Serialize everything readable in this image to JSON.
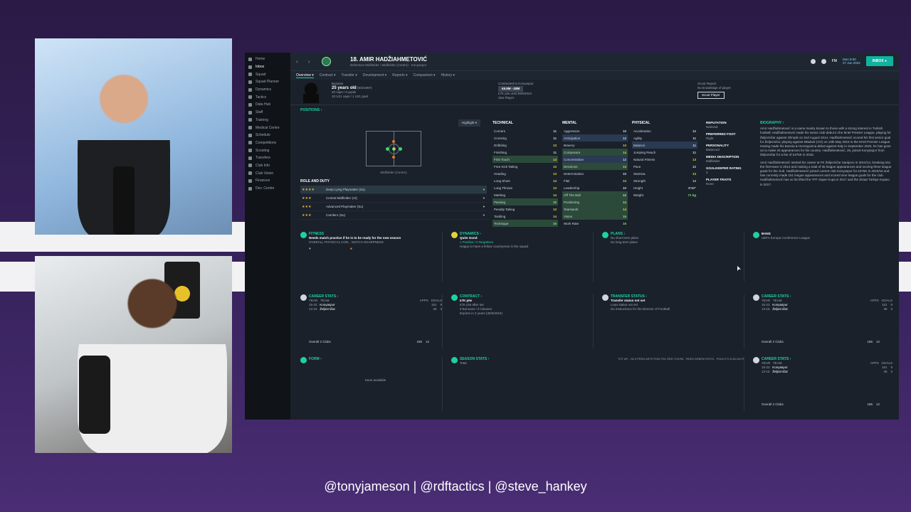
{
  "overlay": {
    "handles": "@tonyjameson | @rdftactics | @steve_hankey"
  },
  "sidebar": {
    "items": [
      {
        "label": "Home"
      },
      {
        "label": "Inbox"
      },
      {
        "label": "Squad"
      },
      {
        "label": "Squad Planner"
      },
      {
        "label": "Dynamics"
      },
      {
        "label": "Tactics"
      },
      {
        "label": "Data Hub"
      },
      {
        "label": "Staff"
      },
      {
        "label": "Training"
      },
      {
        "label": "Medical Centre"
      },
      {
        "label": "Schedule"
      },
      {
        "label": "Competitions"
      },
      {
        "label": "Scouting"
      },
      {
        "label": "Transfers"
      },
      {
        "label": "Club Info"
      },
      {
        "label": "Club Vision"
      },
      {
        "label": "Finances"
      },
      {
        "label": "Dev. Centre"
      }
    ]
  },
  "topbar": {
    "title": "18. AMIR HADŽIAHMETOVIĆ",
    "subtitle": "Defensive Midfielder / Midfielder (Centre) · Konyaspor",
    "fm": "FM",
    "date_day": "Mon 8:00",
    "date": "27 Jun 2022",
    "inbox": "INBOX"
  },
  "tabs": [
    {
      "label": "Overview ▾"
    },
    {
      "label": "Contract ▾"
    },
    {
      "label": "Transfer ▾"
    },
    {
      "label": "Development ▾"
    },
    {
      "label": "Reports ▾"
    },
    {
      "label": "Comparison ▾"
    },
    {
      "label": "History ▾"
    }
  ],
  "header": {
    "nation": "Bosnian",
    "age": "25 years old",
    "dob": "(8/3/1997)",
    "caps": "20 caps / 0 goals",
    "u21": "10 U21 caps / 1 U21 goal",
    "contracted": "Contracted to Konyaspor",
    "value": "£6.9M - £8M",
    "wage": "£7K p/w until 30/6/2024",
    "status": "Star Player",
    "scout_title": "Scout Report",
    "scout_text": "No knowledge of player",
    "scout_btn": "Scout Player"
  },
  "positions": {
    "title": "POSITIONS ›",
    "highlight": "Highlight ▾",
    "pitch_label": "Midfielder (Centre)",
    "role_title": "ROLE AND DUTY",
    "roles": [
      {
        "stars": "★★★★",
        "label": "Deep Lying Playmaker (Su)"
      },
      {
        "stars": "★★★",
        "label": "Central Midfielder (At)"
      },
      {
        "stars": "★★★",
        "label": "Advanced Playmaker (Su)"
      },
      {
        "stars": "★★★",
        "label": "Carrilero (Su)"
      }
    ]
  },
  "technical": {
    "title": "TECHNICAL",
    "rows": [
      {
        "k": "Corners",
        "v": "11"
      },
      {
        "k": "Crossing",
        "v": "11"
      },
      {
        "k": "Dribbling",
        "v": "13"
      },
      {
        "k": "Finishing",
        "v": "11"
      },
      {
        "k": "First Touch",
        "v": "14"
      },
      {
        "k": "Free Kick Taking",
        "v": "13"
      },
      {
        "k": "Heading",
        "v": "13"
      },
      {
        "k": "Long Shots",
        "v": "14"
      },
      {
        "k": "Long Throws",
        "v": "13"
      },
      {
        "k": "Marking",
        "v": "14"
      },
      {
        "k": "Passing",
        "v": "15"
      },
      {
        "k": "Penalty Taking",
        "v": "13"
      },
      {
        "k": "Tackling",
        "v": "14"
      },
      {
        "k": "Technique",
        "v": "15"
      }
    ]
  },
  "mental": {
    "title": "MENTAL",
    "rows": [
      {
        "k": "Aggression",
        "v": "10"
      },
      {
        "k": "Anticipation",
        "v": "12"
      },
      {
        "k": "Bravery",
        "v": "13"
      },
      {
        "k": "Composure",
        "v": "14"
      },
      {
        "k": "Concentration",
        "v": "12"
      },
      {
        "k": "Decisions",
        "v": "13"
      },
      {
        "k": "Determination",
        "v": "10"
      },
      {
        "k": "Flair",
        "v": "13"
      },
      {
        "k": "Leadership",
        "v": "10"
      },
      {
        "k": "Off The Ball",
        "v": "12"
      },
      {
        "k": "Positioning",
        "v": "14"
      },
      {
        "k": "Teamwork",
        "v": "14"
      },
      {
        "k": "Vision",
        "v": "15"
      },
      {
        "k": "Work Rate",
        "v": "15"
      }
    ]
  },
  "physical": {
    "title": "PHYSICAL",
    "rows": [
      {
        "k": "Acceleration",
        "v": "12"
      },
      {
        "k": "Agility",
        "v": "11"
      },
      {
        "k": "Balance",
        "v": "11"
      },
      {
        "k": "Jumping Reach",
        "v": "11"
      },
      {
        "k": "Natural Fitness",
        "v": "13"
      },
      {
        "k": "Pace",
        "v": "12"
      },
      {
        "k": "Stamina",
        "v": "13"
      },
      {
        "k": "Strength",
        "v": "13"
      },
      {
        "k": "Height",
        "v": "5'10\""
      },
      {
        "k": "Weight",
        "v": "71 kg"
      }
    ]
  },
  "info": {
    "reputation_k": "REPUTATION",
    "reputation_v": "National",
    "foot_k": "PREFERRED FOOT",
    "foot_v": "Right",
    "personality_k": "PERSONALITY",
    "personality_v": "Balanced",
    "media_k": "MEDIA DESCRIPTION",
    "media_v": "Midfielder",
    "gk_k": "GOALKEEPER RATING",
    "gk_v": "3",
    "traits_k": "PLAYER TRAITS",
    "traits_v": "None"
  },
  "bio": {
    "title": "BIOGRAPHY ›",
    "p1": "Amir Hadžiahmetović is a name mainly known to those with a strong interest in Turkish football. Hadžiahmetović made his senior club debut in the M:tel Premier League, playing for Željezničar against Olimpik on 2nd August 2014. Hadžiahmetović scored his first senior goal for Željezničar, playing against Mladost (VO) on 13th May 2015 in the M:tel Premier League. Having made his Bosnia & Herzegovina debut against Italy in September 2020, he has gone on to make 20 appearances for his country. Hadžiahmetović, 25, joined Konyaspor from Željezničar for a fee of £375K in 2016.",
    "p2": "Amir Hadžiahmetović started his career at FK Željezničar Sarajevo in 2013/14, breaking into the first-team in 2014 and making a total of 35 league appearances and scoring three league goals for the club. Hadžiahmetović joined current club Konyaspor for £375K in 2015/16 and has currently made 151 league appearances and scored nine league goals for the club. Hadžiahmetović has so far lifted the TFF Süper Kupa in 2017 and the Ziraat Türkiye Kupası in 2017."
  },
  "fitness": {
    "title": "FITNESS",
    "text": "Needs match practice if he is to be ready for the new season",
    "sub": "OVERALL PHYSICAL CON...    MATCH SHARPNESS"
  },
  "dynamics": {
    "title": "DYNAMICS ›",
    "mood": "Quite Good",
    "counts": "1 Positive  /  0 Negatives",
    "text": "Happy to have a fellow countryman in the squad"
  },
  "plans": {
    "title": "PLANS ›",
    "a": "No short term plans",
    "b": "No long term plans"
  },
  "bans": {
    "title": "BANS",
    "text": "UEFA Europa Conference League"
  },
  "career": {
    "title": "CAREER STATS ›",
    "h_year": "YEAR",
    "h_team": "TEAM",
    "h_apps": "APPS",
    "h_goals": "GOALS",
    "rows": [
      {
        "year": "15-23",
        "team": "Konyaspor",
        "apps": "151",
        "goals": "9"
      },
      {
        "year": "13-15",
        "team": "Željezničar",
        "apps": "35",
        "goals": "3"
      }
    ],
    "overall": "Overall  2 Clubs",
    "total_apps": "186",
    "total_goals": "12"
  },
  "contract": {
    "title": "CONTRACT ›",
    "wage": "£7K p/w",
    "l1": "£7K p/w after tax",
    "l2": "0 Bonuses  /  0 Clauses",
    "l3": "Expires in 2 years (30/6/2024)"
  },
  "transfer": {
    "title": "TRANSFER STATUS ›",
    "a": "Transfer status not set",
    "b": "Loan status not set",
    "c": "No instructions for the Director of Football"
  },
  "form": {
    "title": "FORM ›",
    "empty": "None available"
  },
  "season": {
    "title": "SEASON STATS ›",
    "cols": "TOT AP...  GLS  PENS  ASTS  POM  YEL  RED  TCK/90..  PAS%  DRB/90  SHT/G..  FOULS  FLS AG  AV R",
    "row": "Total"
  }
}
